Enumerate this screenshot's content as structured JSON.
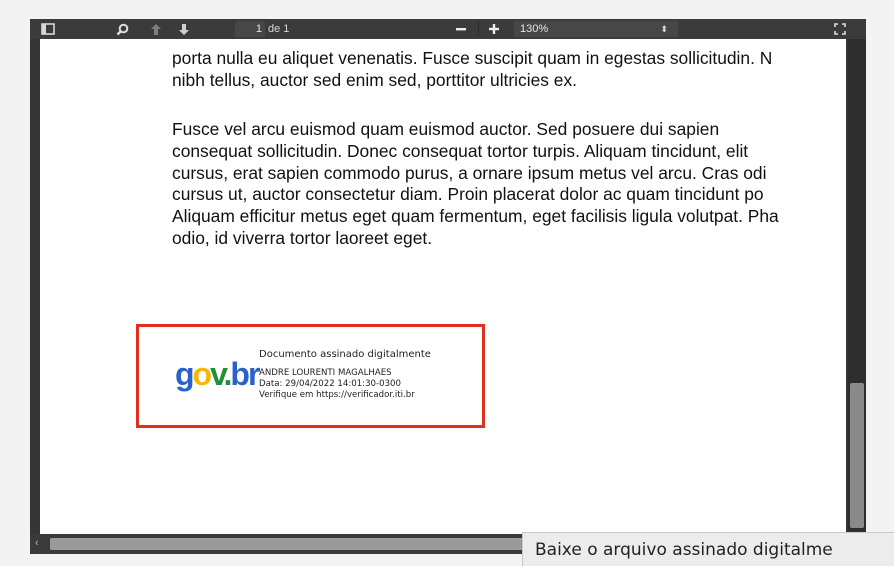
{
  "toolbar": {
    "page_number": "1",
    "page_of": "de 1",
    "zoom": "130%",
    "icons": [
      "sidebar-toggle-icon",
      "search-icon",
      "prev-page-icon",
      "next-page-icon",
      "zoom-out-icon",
      "zoom-in-icon",
      "fullscreen-icon"
    ]
  },
  "document": {
    "paragraph1": [
      "porta nulla eu aliquet venenatis. Fusce suscipit quam in egestas sollicitudin. N",
      "nibh tellus, auctor sed enim sed, porttitor ultricies ex."
    ],
    "paragraph2": [
      "Fusce vel arcu euismod quam euismod auctor. Sed posuere dui sapien",
      "consequat sollicitudin. Donec consequat tortor turpis. Aliquam tincidunt, elit",
      "cursus, erat sapien commodo purus, a ornare ipsum metus vel arcu. Cras odi",
      "cursus ut, auctor consectetur diam. Proin placerat dolor ac quam tincidunt po",
      "Aliquam efficitur metus eget quam fermentum, eget facilisis ligula volutpat. Pha",
      "odio, id viverra tortor laoreet eget."
    ],
    "signature": {
      "logo_parts": [
        "g",
        "o",
        "v",
        ".",
        "b",
        "r"
      ],
      "logo_colors": [
        "#2a62c9",
        "#f5b700",
        "#1f8f3a",
        "#1f8f3a",
        "#2a62c9",
        "#2a62c9"
      ],
      "title": "Documento assinado digitalmente",
      "signer": "ANDRE LOURENTI MAGALHAES",
      "date": "Data: 29/04/2022 14:01:30-0300",
      "verify": "Verifique em https://verificador.iti.br",
      "border_color": "#e2301f"
    }
  },
  "tooltip": {
    "text": "Baixe o arquivo assinado digitalme"
  }
}
